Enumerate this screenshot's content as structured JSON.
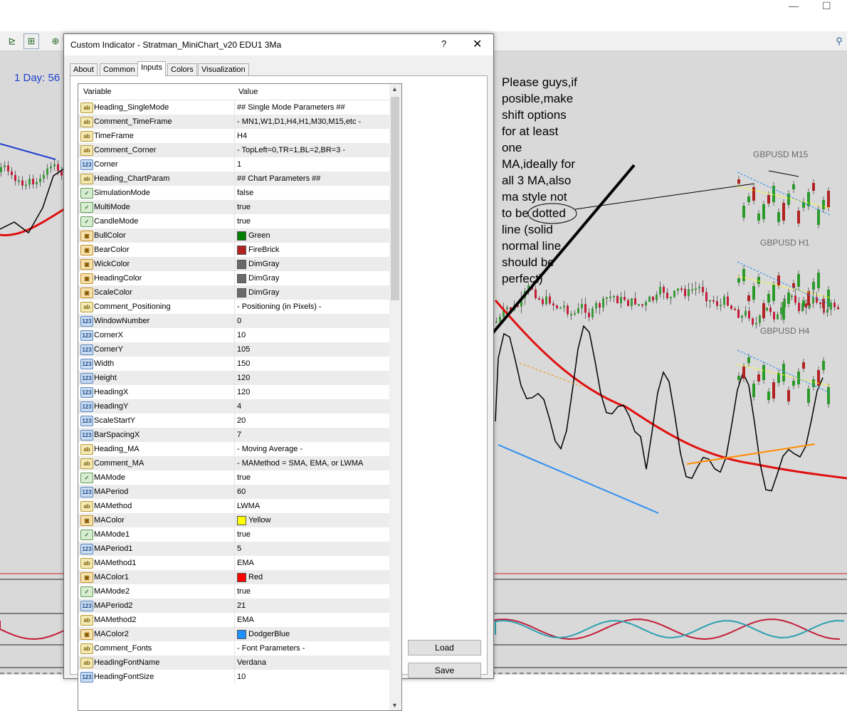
{
  "window": {
    "minimize_glyph": "—",
    "maximize_glyph": "☐"
  },
  "chart": {
    "day_label": "1 Day: 56",
    "note": "Please guys,if\nposible,make\nshift options\nfor at least\none\nMA,ideally for\nall 3 MA,also\nma style not\nto be dotted\nline (solid\nnormal line\nshould be\nperfect)",
    "mini_labels": [
      "GBPUSD M15",
      "GBPUSD H1",
      "GBPUSD H4"
    ],
    "colors": {
      "background": "#d9d9d9",
      "bull": "#3a9a3a",
      "bear": "#c41e3a",
      "ma_red": "#e01010",
      "ma_blue": "#2f8ff0",
      "ma_orange": "#ff8c00"
    }
  },
  "dialog": {
    "title": "Custom Indicator - Stratman_MiniChart_v20 EDU1 3Ma",
    "help_glyph": "?",
    "close_glyph": "✕",
    "tabs": [
      "About",
      "Common",
      "Inputs",
      "Colors",
      "Visualization"
    ],
    "active_tab": "Inputs",
    "columns": [
      "Variable",
      "Value"
    ],
    "rows": [
      {
        "icon": "ab",
        "name": "Heading_SingleMode",
        "value": "## Single Mode Parameters ##"
      },
      {
        "icon": "ab",
        "name": "Comment_TimeFrame",
        "value": " - MN1,W1,D1,H4,H1,M30,M15,etc -"
      },
      {
        "icon": "ab",
        "name": "TimeFrame",
        "value": "H4"
      },
      {
        "icon": "ab",
        "name": "Comment_Corner",
        "value": " - TopLeft=0,TR=1,BL=2,BR=3 -"
      },
      {
        "icon": "123",
        "name": "Corner",
        "value": "1"
      },
      {
        "icon": "ab",
        "name": "Heading_ChartParam",
        "value": "## Chart Parameters ##"
      },
      {
        "icon": "bool",
        "name": "SimulationMode",
        "value": "false"
      },
      {
        "icon": "bool",
        "name": "MultiMode",
        "value": "true"
      },
      {
        "icon": "bool",
        "name": "CandleMode",
        "value": "true"
      },
      {
        "icon": "color",
        "name": "BullColor",
        "value": "Green",
        "swatch": "#008000"
      },
      {
        "icon": "color",
        "name": "BearColor",
        "value": "FireBrick",
        "swatch": "#b22222"
      },
      {
        "icon": "color",
        "name": "WickColor",
        "value": "DimGray",
        "swatch": "#696969"
      },
      {
        "icon": "color",
        "name": "HeadingColor",
        "value": "DimGray",
        "swatch": "#696969"
      },
      {
        "icon": "color",
        "name": "ScaleColor",
        "value": "DimGray",
        "swatch": "#696969"
      },
      {
        "icon": "ab",
        "name": "Comment_Positioning",
        "value": " - Positioning (in Pixels) -"
      },
      {
        "icon": "123",
        "name": "WindowNumber",
        "value": "0"
      },
      {
        "icon": "123",
        "name": "CornerX",
        "value": "10"
      },
      {
        "icon": "123",
        "name": "CornerY",
        "value": "105"
      },
      {
        "icon": "123",
        "name": "Width",
        "value": "150"
      },
      {
        "icon": "123",
        "name": "Height",
        "value": "120"
      },
      {
        "icon": "123",
        "name": "HeadingX",
        "value": "120"
      },
      {
        "icon": "123",
        "name": "HeadingY",
        "value": "4"
      },
      {
        "icon": "123",
        "name": "ScaleStartY",
        "value": "20"
      },
      {
        "icon": "123",
        "name": "BarSpacingX",
        "value": "7"
      },
      {
        "icon": "ab",
        "name": "Heading_MA",
        "value": " - Moving Average -"
      },
      {
        "icon": "ab",
        "name": "Comment_MA",
        "value": " - MAMethod = SMA, EMA, or LWMA"
      },
      {
        "icon": "bool",
        "name": "MAMode",
        "value": "true"
      },
      {
        "icon": "123",
        "name": "MAPeriod",
        "value": "60"
      },
      {
        "icon": "ab",
        "name": "MAMethod",
        "value": "LWMA"
      },
      {
        "icon": "color",
        "name": "MAColor",
        "value": "Yellow",
        "swatch": "#ffff00"
      },
      {
        "icon": "bool",
        "name": "MAMode1",
        "value": "true"
      },
      {
        "icon": "123",
        "name": "MAPeriod1",
        "value": "5"
      },
      {
        "icon": "ab",
        "name": "MAMethod1",
        "value": "EMA"
      },
      {
        "icon": "color",
        "name": "MAColor1",
        "value": "Red",
        "swatch": "#ff0000"
      },
      {
        "icon": "bool",
        "name": "MAMode2",
        "value": "true"
      },
      {
        "icon": "123",
        "name": "MAPeriod2",
        "value": "21"
      },
      {
        "icon": "ab",
        "name": "MAMethod2",
        "value": "EMA"
      },
      {
        "icon": "color",
        "name": "MAColor2",
        "value": "DodgerBlue",
        "swatch": "#1e90ff"
      },
      {
        "icon": "ab",
        "name": "Comment_Fonts",
        "value": " - Font Parameters -"
      },
      {
        "icon": "ab",
        "name": "HeadingFontName",
        "value": "Verdana"
      },
      {
        "icon": "123",
        "name": "HeadingFontSize",
        "value": "10"
      }
    ],
    "buttons": {
      "load": "Load",
      "save": "Save"
    }
  }
}
